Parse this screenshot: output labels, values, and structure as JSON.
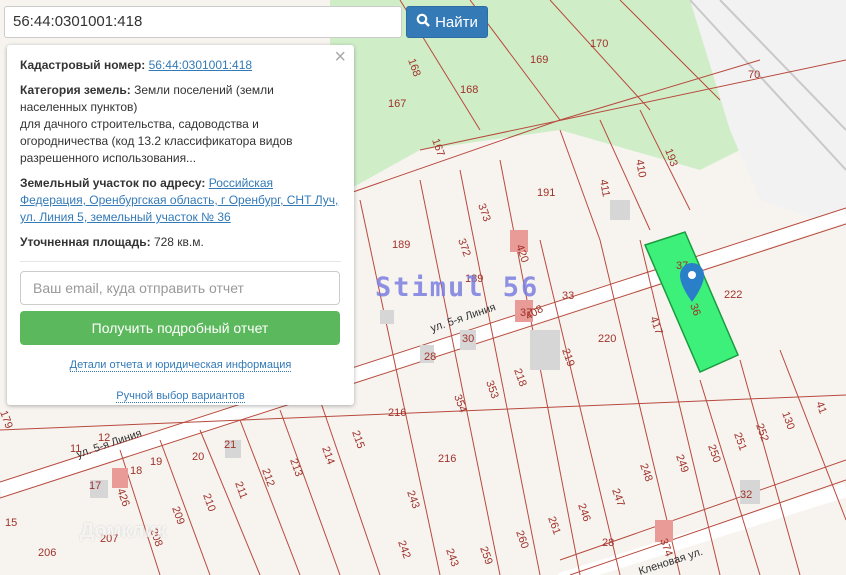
{
  "search": {
    "value": "56:44:0301001:418",
    "button_label": "Найти",
    "icon": "search-icon"
  },
  "info": {
    "cadastral_label": "Кадастровый номер:",
    "cadastral_value": "56:44:0301001:418",
    "category_label": "Категория земель:",
    "category_value": "Земли поселений (земли населенных пунктов)",
    "usage_text": "для дачного строительства, садоводства и огородничества (код 13.2 классификатора видов разрешенного использования...",
    "address_label": "Земельный участок по адресу:",
    "address_value": "Российская Федерация, Оренбургская область, г Оренбург, СНТ Луч, ул. Линия 5, земельный участок № 36",
    "area_label": "Уточненная площадь:",
    "area_value": "728 кв.м.",
    "email_placeholder": "Ваш email, куда отправить отчет",
    "report_button": "Получить подробный отчет",
    "details_link": "Детали отчета и юридическая информация",
    "manual_link": "Ручной выбор вариантов",
    "close": "×"
  },
  "watermark": "Stimul 56",
  "domclick": "Домклик",
  "map": {
    "streets": [
      "ул. 5-я Линия",
      "ул. 5-я Линия",
      "Кленовая ул."
    ],
    "labels": [
      "170",
      "169",
      "168",
      "168",
      "167",
      "167",
      "70",
      "410",
      "411",
      "193",
      "191",
      "373",
      "372",
      "189",
      "189",
      "420",
      "37",
      "222",
      "417",
      "33",
      "37",
      "408",
      "220",
      "219",
      "218",
      "353",
      "354",
      "30",
      "28",
      "216",
      "216",
      "215",
      "214",
      "213",
      "212",
      "211",
      "210",
      "209",
      "208",
      "207",
      "206",
      "21",
      "20",
      "19",
      "18",
      "17",
      "15",
      "12",
      "11",
      "426",
      "243",
      "242",
      "243",
      "259",
      "260",
      "261",
      "246",
      "247",
      "248",
      "249",
      "250",
      "251",
      "252",
      "130",
      "41",
      "32",
      "28",
      "374",
      "36",
      "179"
    ],
    "highlight_color": "#3cf07a"
  }
}
